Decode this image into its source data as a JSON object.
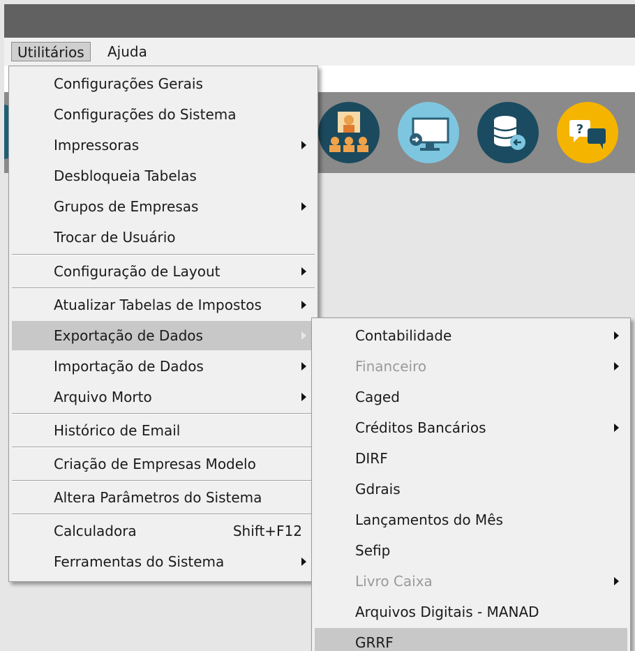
{
  "menubar": {
    "items": [
      "Utilitários",
      "Ajuda"
    ]
  },
  "utilitarios_menu": {
    "items": [
      {
        "label": "Configurações Gerais"
      },
      {
        "label": "Configurações do Sistema"
      },
      {
        "label": "Impressoras"
      },
      {
        "label": "Desbloqueia Tabelas"
      },
      {
        "label": "Grupos de Empresas"
      },
      {
        "label": "Trocar de Usuário"
      },
      {
        "label": "Configuração de Layout"
      },
      {
        "label": "Atualizar Tabelas de Impostos"
      },
      {
        "label": "Exportação de Dados"
      },
      {
        "label": "Importação de Dados"
      },
      {
        "label": "Arquivo Morto"
      },
      {
        "label": "Histórico de Email"
      },
      {
        "label": "Criação de Empresas Modelo"
      },
      {
        "label": "Altera Parâmetros do Sistema"
      },
      {
        "label": "Calculadora",
        "shortcut": "Shift+F12"
      },
      {
        "label": "Ferramentas do Sistema"
      }
    ]
  },
  "exportacao_submenu": {
    "items": [
      {
        "label": "Contabilidade"
      },
      {
        "label": "Financeiro"
      },
      {
        "label": "Caged"
      },
      {
        "label": "Créditos Bancários"
      },
      {
        "label": "DIRF"
      },
      {
        "label": "Gdrais"
      },
      {
        "label": "Lançamentos do Mês"
      },
      {
        "label": "Sefip"
      },
      {
        "label": "Livro Caixa"
      },
      {
        "label": "Arquivos Digitais - MANAD"
      },
      {
        "label": "GRRF"
      }
    ]
  },
  "toolbar": {
    "icons": [
      "meeting-icon",
      "monitor-icon",
      "database-icon",
      "help-chat-icon"
    ]
  },
  "colors": {
    "menu_bg": "#f0f0f0",
    "highlight": "#c8c8c8",
    "disabled_text": "#9a9a9a",
    "toolbar_bg": "#8a8a8a",
    "titlebar": "#616161"
  }
}
